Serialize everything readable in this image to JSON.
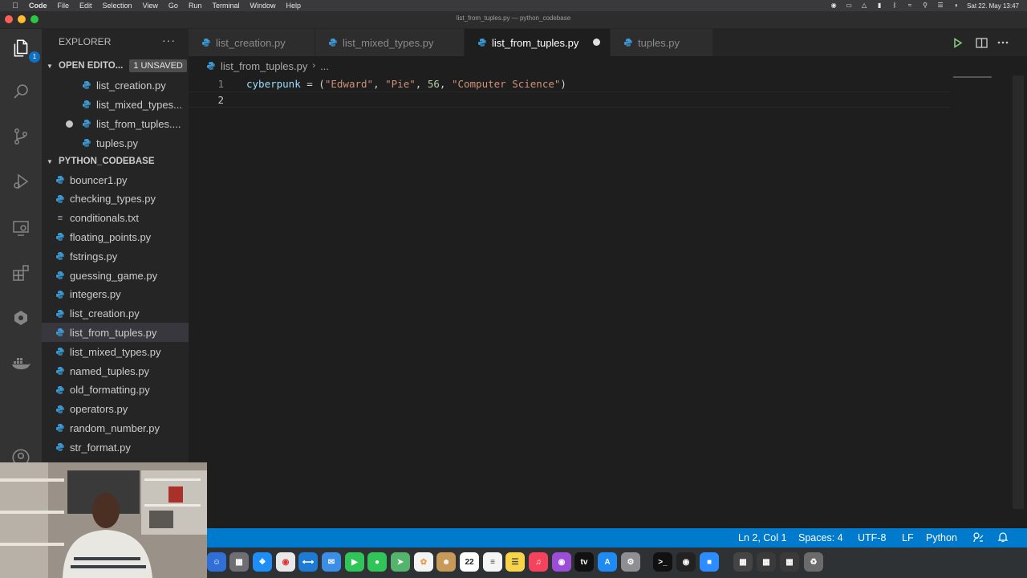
{
  "menubar": {
    "app_name": "Code",
    "items": [
      "File",
      "Edit",
      "Selection",
      "View",
      "Go",
      "Run",
      "Terminal",
      "Window",
      "Help"
    ],
    "clock": "Sat 22. May  13:47"
  },
  "window": {
    "title": "list_from_tuples.py — python_codebase"
  },
  "activity_bar": {
    "explorer_badge": "1",
    "icons": [
      "files-icon",
      "search-icon",
      "source-control-icon",
      "run-debug-icon",
      "remote-explorer-icon",
      "extensions-icon",
      "gitlens-icon",
      "docker-icon",
      "account-icon"
    ]
  },
  "explorer": {
    "title": "EXPLORER",
    "more": "···",
    "open_editors": {
      "label": "OPEN EDITO...",
      "badge": "1 UNSAVED",
      "items": [
        {
          "name": "list_creation.py",
          "modified": false
        },
        {
          "name": "list_mixed_types...",
          "modified": false
        },
        {
          "name": "list_from_tuples....",
          "modified": true
        },
        {
          "name": "tuples.py",
          "modified": false
        }
      ]
    },
    "folder": {
      "label": "PYTHON_CODEBASE",
      "files": [
        {
          "name": "bouncer1.py",
          "type": "py"
        },
        {
          "name": "checking_types.py",
          "type": "py"
        },
        {
          "name": "conditionals.txt",
          "type": "txt"
        },
        {
          "name": "floating_points.py",
          "type": "py"
        },
        {
          "name": "fstrings.py",
          "type": "py"
        },
        {
          "name": "guessing_game.py",
          "type": "py"
        },
        {
          "name": "integers.py",
          "type": "py"
        },
        {
          "name": "list_creation.py",
          "type": "py"
        },
        {
          "name": "list_from_tuples.py",
          "type": "py",
          "selected": true
        },
        {
          "name": "list_mixed_types.py",
          "type": "py"
        },
        {
          "name": "named_tuples.py",
          "type": "py"
        },
        {
          "name": "old_formatting.py",
          "type": "py"
        },
        {
          "name": "operators.py",
          "type": "py"
        },
        {
          "name": "random_number.py",
          "type": "py"
        },
        {
          "name": "str_format.py",
          "type": "py"
        }
      ]
    }
  },
  "tabs": [
    {
      "label": "list_creation.py",
      "active": false,
      "modified": false
    },
    {
      "label": "list_mixed_types.py",
      "active": false,
      "modified": false
    },
    {
      "label": "list_from_tuples.py",
      "active": true,
      "modified": true
    },
    {
      "label": "tuples.py",
      "active": false,
      "modified": false
    }
  ],
  "breadcrumb": {
    "file": "list_from_tuples.py",
    "rest": "..."
  },
  "editor": {
    "line_numbers": [
      "1",
      "2"
    ],
    "line1": {
      "var": "cyberpunk",
      "op": " = (",
      "s1": "\"Edward\"",
      "c1": ", ",
      "s2": "\"Pie\"",
      "c2": ", ",
      "num": "56",
      "c3": ", ",
      "s3": "\"Computer Science\"",
      "close": ")"
    }
  },
  "statusbar": {
    "position": "Ln 2, Col 1",
    "spaces": "Spaces: 4",
    "encoding": "UTF-8",
    "eol": "LF",
    "language": "Python"
  },
  "colors": {
    "statusbar": "#007acc",
    "python_icon": "#3b9ad6",
    "string": "#ce9178",
    "variable": "#9cdcfe",
    "number": "#b5cea8"
  }
}
